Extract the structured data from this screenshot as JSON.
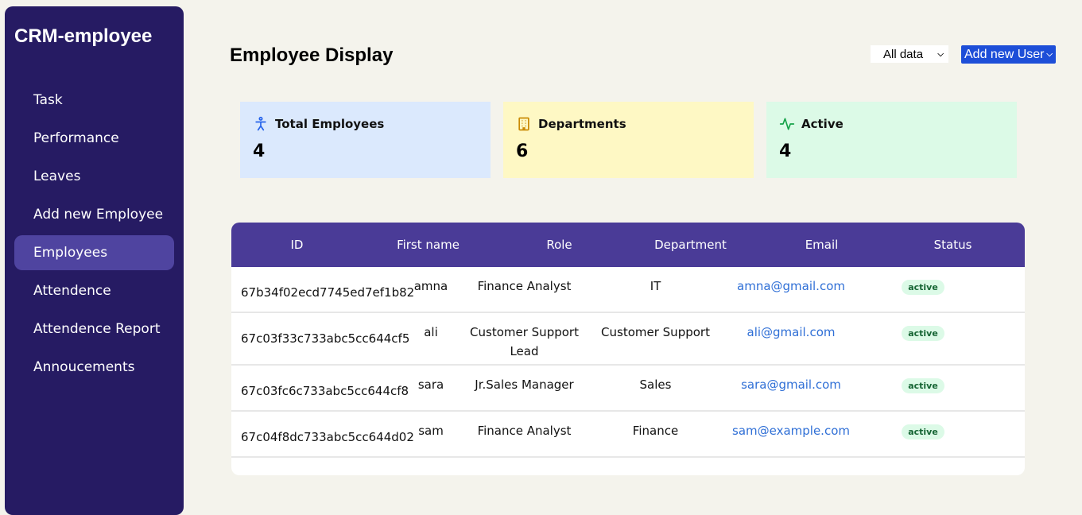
{
  "sidebar": {
    "brand": "CRM-employee",
    "items": [
      {
        "label": "Task"
      },
      {
        "label": "Performance"
      },
      {
        "label": "Leaves"
      },
      {
        "label": "Add new Employee"
      },
      {
        "label": "Employees"
      },
      {
        "label": "Attendence"
      },
      {
        "label": "Attendence Report"
      },
      {
        "label": "Annoucements"
      }
    ],
    "active_item": "Employees"
  },
  "header": {
    "title": "Employee Display",
    "filter_value": "All data",
    "add_user_label": "Add new User"
  },
  "stats": [
    {
      "title": "Total Employees",
      "value": "4",
      "icon": "accessibility-icon",
      "color": "#dbe9fd"
    },
    {
      "title": "Departments",
      "value": "6",
      "icon": "building-icon",
      "color": "#fef8c4"
    },
    {
      "title": "Active",
      "value": "4",
      "icon": "activity-icon",
      "color": "#dcfae7"
    }
  ],
  "table": {
    "columns": [
      "ID",
      "First name",
      "Role",
      "Department",
      "Email",
      "Status"
    ],
    "rows": [
      {
        "id": "67b34f02ecd7745ed7ef1b82",
        "first_name": "amna",
        "role": "Finance Analyst",
        "department": "IT",
        "email": "amna@gmail.com",
        "status": "active"
      },
      {
        "id": "67c03f33c733abc5cc644cf5",
        "first_name": "ali",
        "role": "Customer Support Lead",
        "department": "Customer Support",
        "email": "ali@gmail.com",
        "status": "active"
      },
      {
        "id": "67c03fc6c733abc5cc644cf8",
        "first_name": "sara",
        "role": "Jr.Sales Manager",
        "department": "Sales",
        "email": "sara@gmail.com",
        "status": "active"
      },
      {
        "id": "67c04f8dc733abc5cc644d02",
        "first_name": "sam",
        "role": "Finance Analyst",
        "department": "Finance",
        "email": "sam@example.com",
        "status": "active"
      }
    ]
  },
  "colors": {
    "sidebar_bg": "#261b63",
    "active_nav": "#4f44a0",
    "table_header": "#4a3b97",
    "accent_button": "#1d4ed8"
  }
}
